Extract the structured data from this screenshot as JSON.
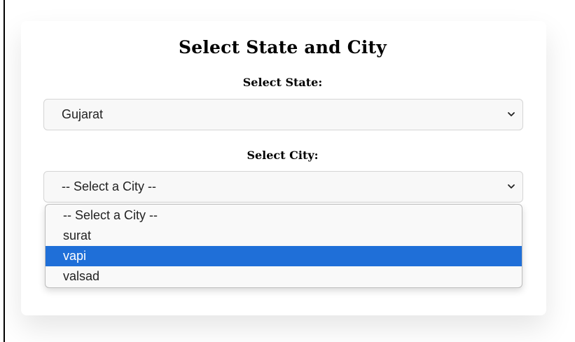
{
  "form": {
    "title": "Select State and City",
    "state_label": "Select State:",
    "state_value": "Gujarat",
    "city_label": "Select City:",
    "city_value": "-- Select a City --"
  },
  "city_dropdown": {
    "options": [
      {
        "label": "-- Select a City --"
      },
      {
        "label": "surat"
      },
      {
        "label": "vapi",
        "highlighted": true
      },
      {
        "label": "valsad"
      }
    ]
  },
  "colors": {
    "highlight": "#1f6fd8",
    "select_background": "#f8f8f8",
    "select_border": "#d5d5d5"
  },
  "icons": {
    "state_select": "chevron-down-icon",
    "city_select": "chevron-down-icon"
  }
}
